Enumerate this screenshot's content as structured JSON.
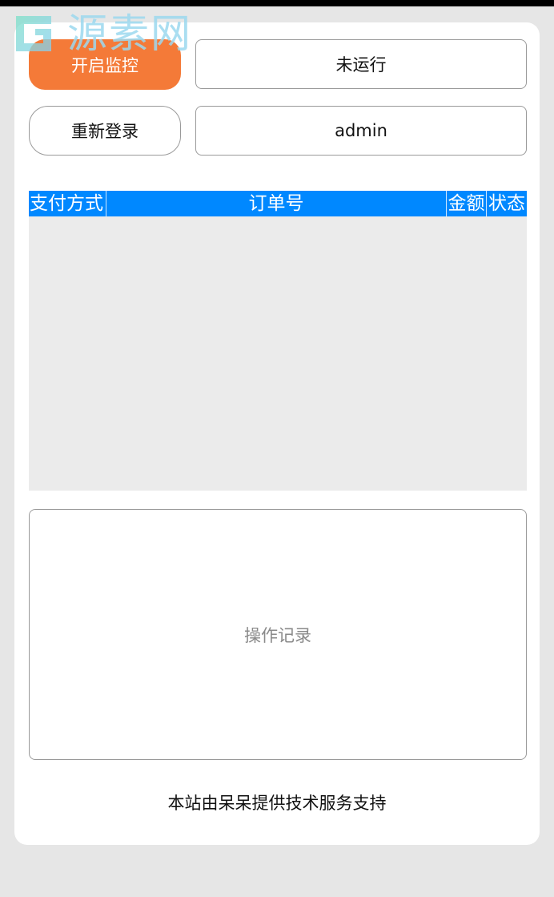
{
  "watermark": {
    "text": "源素网"
  },
  "controls": {
    "start_label": "开启监控",
    "status_value": "未运行",
    "relogin_label": "重新登录",
    "user_value": "admin"
  },
  "table": {
    "columns": [
      "支付方式",
      "订单号",
      "金额",
      "状态"
    ],
    "rows": []
  },
  "log": {
    "placeholder": "操作记录"
  },
  "footer": {
    "text": "本站由呆呆提供技术服务支持"
  },
  "colors": {
    "accent": "#f47a38",
    "header": "#0088ff",
    "background": "#e6e6e6",
    "table_body": "#ebebeb"
  }
}
